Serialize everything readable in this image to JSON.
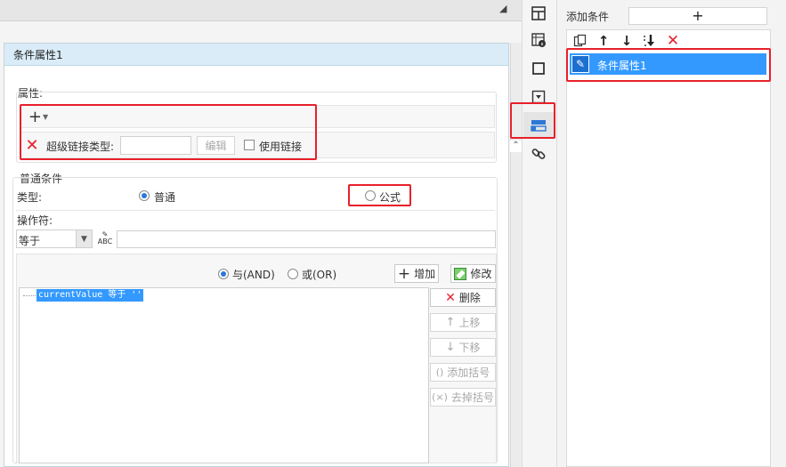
{
  "dialog": {
    "title": "条件属性1",
    "attr_section": "属性:",
    "hyperlink_type_label": "超级链接类型:",
    "hyperlink_type_value": "",
    "edit_button": "编辑",
    "use_link_label": "使用链接",
    "normal_condition_section": "普通条件",
    "type_label": "类型:",
    "type_options": [
      "普通",
      "公式"
    ],
    "type_selected": "普通",
    "operator_label": "操作符:",
    "operator_value": "等于",
    "operator_input": "",
    "and_label": "与(AND)",
    "or_label": "或(OR)",
    "logic_selected": "与(AND)",
    "add_button": "增加",
    "modify_button": "修改",
    "delete_button": "删除",
    "move_up_button": "上移",
    "move_down_button": "下移",
    "add_bracket_button": "添加括号",
    "remove_bracket_button": "去掉括号",
    "condition_tree": [
      "currentValue 等于 ''"
    ]
  },
  "right_panel": {
    "add_condition_label": "添加条件",
    "add_symbol": "+",
    "conditions": [
      "条件属性1"
    ],
    "selected_condition": "条件属性1"
  },
  "toolbar": {
    "icons": [
      "layout-icon",
      "info-grid-icon",
      "frame-icon",
      "dropdown-icon",
      "condition-property-icon",
      "hyperlink-icon"
    ],
    "active": "condition-property-icon"
  },
  "colors": {
    "accent": "#2b78d8",
    "selection": "#3399ff",
    "highlight_box": "#e8202a",
    "dialog_header": "#d9ecf8"
  }
}
